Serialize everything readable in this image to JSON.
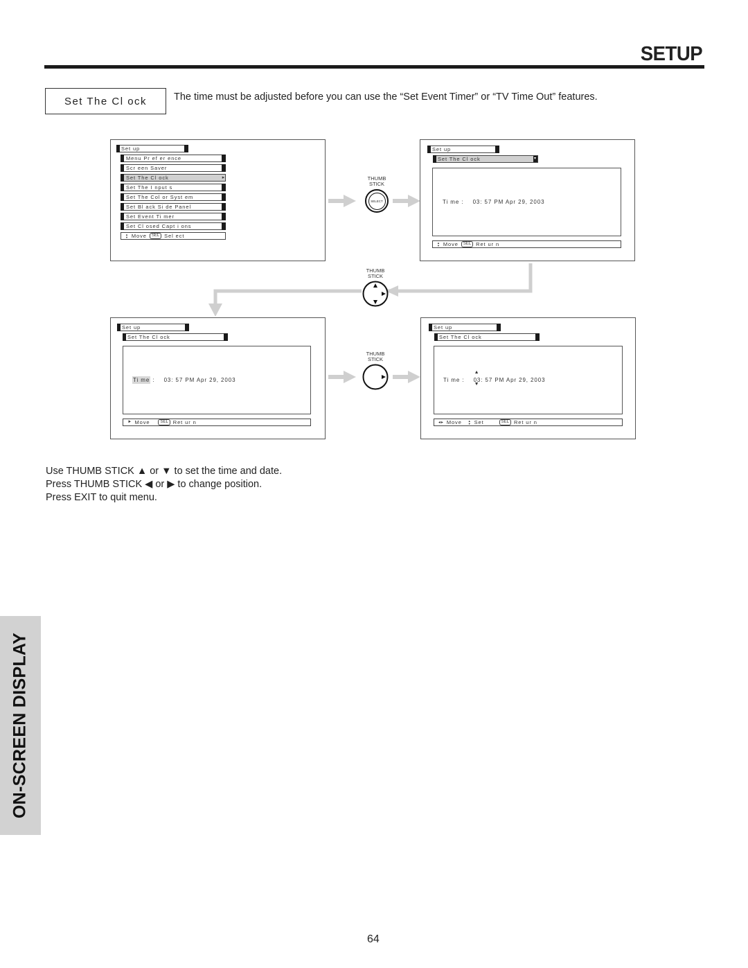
{
  "header": {
    "title": "SETUP"
  },
  "section": {
    "label": "Set  The  Cl ock",
    "intro": "The time must be adjusted before you can use the “Set Event Timer” or “TV Time Out” features."
  },
  "thumb_stick": {
    "label_line1": "THUMB",
    "label_line2": "STICK",
    "select_label": "SELECT"
  },
  "screens": {
    "menu": {
      "title": "Set up",
      "items": [
        {
          "label": "Menu  Pr ef er ence"
        },
        {
          "label": "Scr een  Saver"
        },
        {
          "label": "Set  The  Cl ock",
          "selected": true
        },
        {
          "label": "Set  The  I nput s"
        },
        {
          "label": "Set  The  Col or  Syst em"
        },
        {
          "label": "Set  Bl ack  Si de  Panel"
        },
        {
          "label": "Set  Event  Ti mer"
        },
        {
          "label": "Set  Cl osed  Capt i ons"
        }
      ],
      "status": {
        "move": "Move",
        "sel": "SEL",
        "action": "Sel ect"
      },
      "selected_arrow": "▸"
    },
    "clock_entry": {
      "title": "Set up",
      "subtitle": "Set  The  Cl ock",
      "down_arrow": "▾",
      "time_label": "Ti me  :",
      "time_value": "03: 57  PM Apr  29,  2003",
      "status": {
        "move": "Move",
        "sel": "SEL",
        "action": "Ret ur n"
      }
    },
    "clock_time_focus": {
      "title": "Set up",
      "subtitle": "Set  The  Cl ock",
      "time_label": "Ti me",
      "time_colon": ":",
      "time_value": "03: 57  PM Apr  29,  2003",
      "status": {
        "move": "Move",
        "sel": "SEL",
        "action": "Ret ur n"
      }
    },
    "clock_edit": {
      "title": "Set up",
      "subtitle": "Set  The  Cl ock",
      "time_label": "Ti me  :",
      "time_hour": "03",
      "time_rest": ": 57  PM Apr  29,  2003",
      "up_arrow": "▲",
      "down_arrow": "▼",
      "status": {
        "move_arrows": "◂▸",
        "move": "Move",
        "set": "Set",
        "sel": "SEL",
        "action": "Ret ur n"
      }
    }
  },
  "instructions": [
    "Use THUMB STICK ▲ or ▼ to set the time and date.",
    "Press THUMB STICK ◀ or ▶ to change position.",
    "Press EXIT to quit menu."
  ],
  "sidebar": {
    "label": "ON-SCREEN DISPLAY"
  },
  "page_number": "64"
}
